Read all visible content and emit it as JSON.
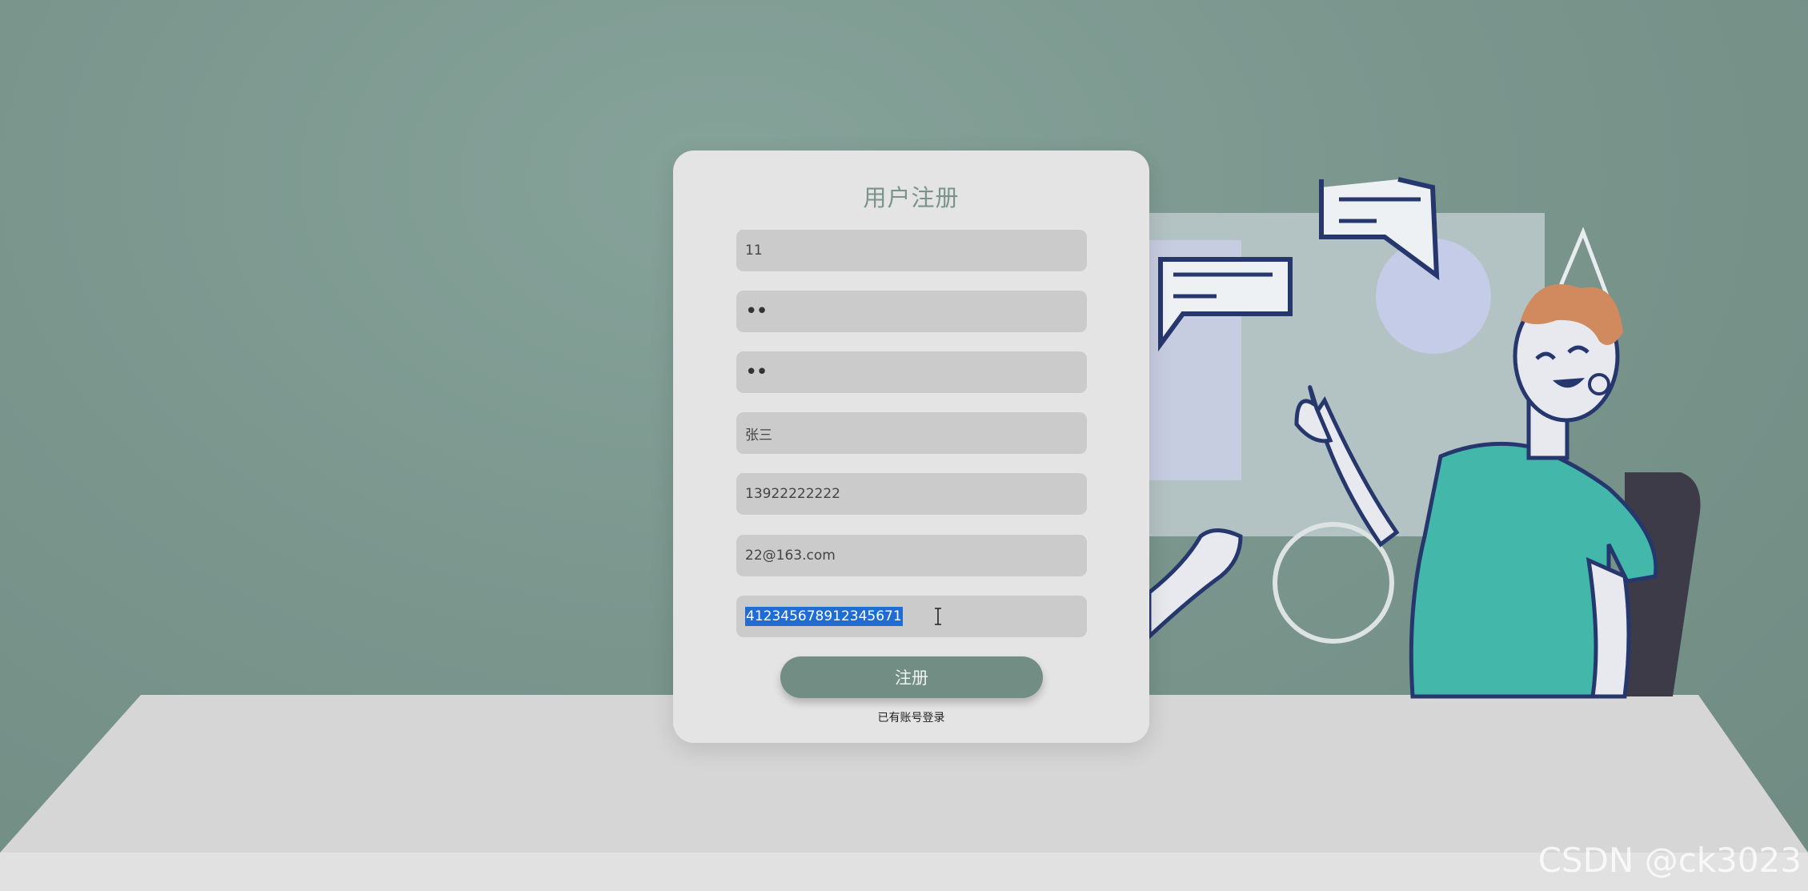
{
  "form": {
    "title": "用户注册",
    "fields": [
      {
        "name": "username",
        "value": "11"
      },
      {
        "name": "password",
        "value": "••"
      },
      {
        "name": "confirm-password",
        "value": "••"
      },
      {
        "name": "real-name",
        "value": "张三"
      },
      {
        "name": "phone",
        "value": "13922222222"
      },
      {
        "name": "email",
        "value": "22@163.com"
      },
      {
        "name": "id-number",
        "value": "412345678912345671",
        "selected": true
      }
    ],
    "submit_label": "注册",
    "login_link": "已有账号登录"
  },
  "watermark": "CSDN @ck3023",
  "colors": {
    "background": "#7a968d",
    "card": "#e4e4e4",
    "input": "#cbcbcb",
    "accent": "#728d84",
    "selection": "#1f6cd2",
    "shirt": "#43b8aa",
    "hair": "#d08a5e",
    "outline": "#25376d"
  }
}
